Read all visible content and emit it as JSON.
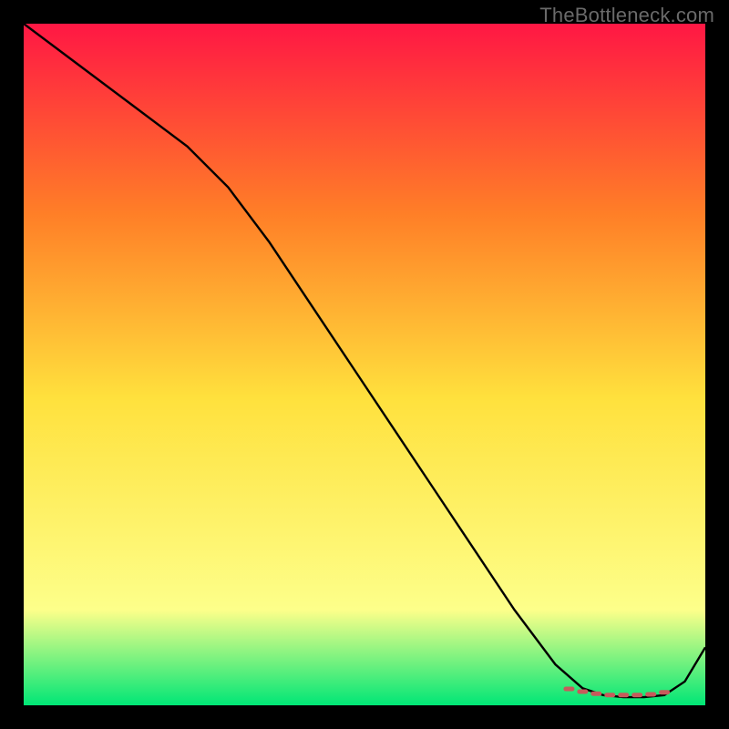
{
  "watermark": "TheBottleneck.com",
  "chart_data": {
    "type": "line",
    "title": "",
    "xlabel": "",
    "ylabel": "",
    "xlim": [
      0,
      100
    ],
    "ylim": [
      0,
      100
    ],
    "grid": false,
    "legend": false,
    "gradient": {
      "top": "#ff1744",
      "mid_upper": "#ff7f27",
      "mid": "#ffe13d",
      "mid_lower": "#fdff8a",
      "bottom": "#00e676"
    },
    "series": [
      {
        "name": "curve",
        "stroke": "#000000",
        "x": [
          0,
          8,
          16,
          24,
          30,
          36,
          42,
          48,
          54,
          60,
          66,
          72,
          78,
          82,
          85,
          88,
          91,
          94,
          97,
          100
        ],
        "values": [
          100,
          94,
          88,
          82,
          76,
          68,
          59,
          50,
          41,
          32,
          23,
          14,
          6,
          2.5,
          1.5,
          1.2,
          1.2,
          1.5,
          3.5,
          8.5
        ]
      },
      {
        "name": "markers-trough",
        "marker_color": "#c65b5b",
        "x": [
          80,
          82,
          84,
          86,
          88,
          90,
          92,
          94
        ],
        "values": [
          2.4,
          2.0,
          1.7,
          1.5,
          1.5,
          1.5,
          1.6,
          1.9
        ]
      }
    ]
  }
}
